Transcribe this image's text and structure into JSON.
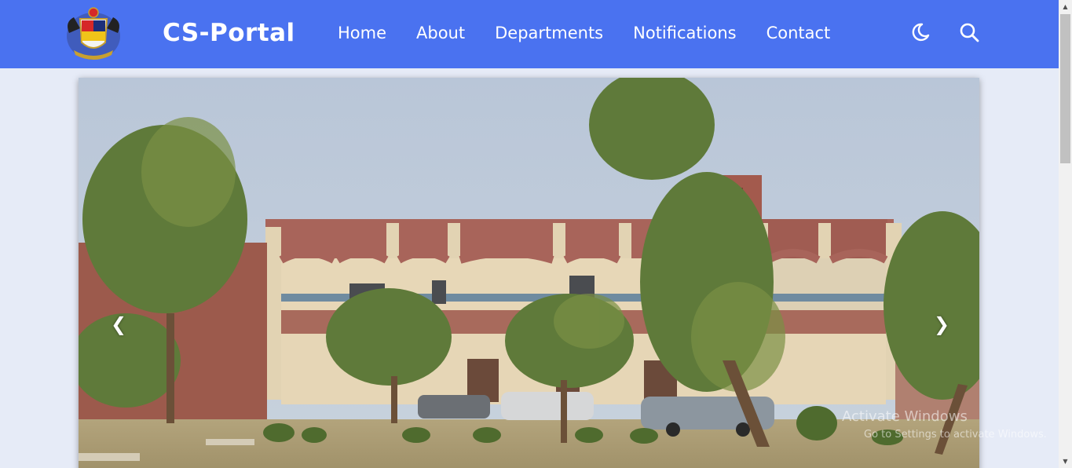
{
  "header": {
    "brand": "CS-Portal",
    "nav": [
      "Home",
      "About",
      "Departments",
      "Notifications",
      "Contact"
    ],
    "bg_color": "#4a72f0",
    "icons": {
      "logo": "college-emblem",
      "theme": "moon-icon",
      "search": "search-icon"
    }
  },
  "carousel": {
    "prev_label": "❮",
    "next_label": "❯",
    "image": "campus-building-photo"
  },
  "watermark": {
    "line1": "Activate Windows",
    "line2": "Go to Settings to activate Windows."
  }
}
